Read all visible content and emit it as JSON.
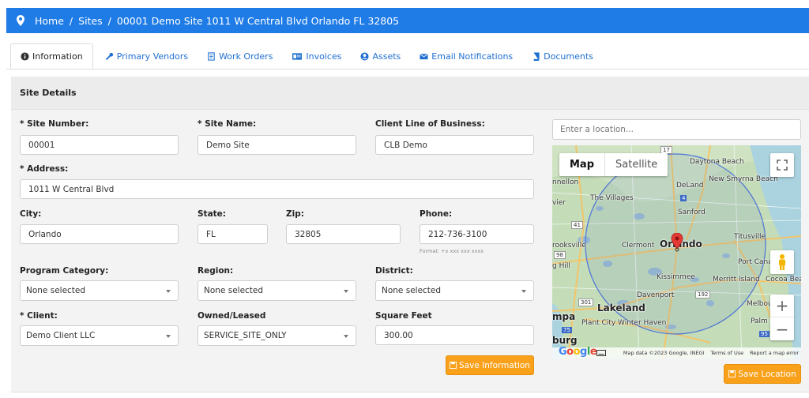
{
  "breadcrumb": {
    "home": "Home",
    "sites": "Sites",
    "current": "00001 Demo Site 1011 W Central Blvd Orlando FL 32805"
  },
  "tabs": [
    {
      "label": "Information",
      "icon": "info-icon"
    },
    {
      "label": "Primary Vendors",
      "icon": "wrench-icon"
    },
    {
      "label": "Work Orders",
      "icon": "document-icon"
    },
    {
      "label": "Invoices",
      "icon": "invoice-icon"
    },
    {
      "label": "Assets",
      "icon": "user-circle-icon"
    },
    {
      "label": "Email Notifications",
      "icon": "envelope-icon"
    },
    {
      "label": "Documents",
      "icon": "book-icon"
    }
  ],
  "section_title": "Site Details",
  "form": {
    "site_number": {
      "label": "* Site Number:",
      "value": "00001"
    },
    "site_name": {
      "label": "* Site Name:",
      "value": "Demo Site"
    },
    "client_lob": {
      "label": "Client Line of Business:",
      "value": "CLB Demo"
    },
    "address": {
      "label": "* Address:",
      "value": "1011 W Central Blvd"
    },
    "city": {
      "label": "City:",
      "value": "Orlando"
    },
    "state": {
      "label": "State:",
      "value": "FL"
    },
    "zip": {
      "label": "Zip:",
      "value": "32805"
    },
    "phone": {
      "label": "Phone:",
      "value": "212-736-3100",
      "hint": "Format: +x xxx xxx xxxx"
    },
    "program_category": {
      "label": "Program Category:",
      "value": "None selected"
    },
    "region": {
      "label": "Region:",
      "value": "None selected"
    },
    "district": {
      "label": "District:",
      "value": "None selected"
    },
    "client": {
      "label": "* Client:",
      "value": "Demo Client LLC"
    },
    "owned_leased": {
      "label": "Owned/Leased",
      "value": "SERVICE_SITE_ONLY"
    },
    "square_feet": {
      "label": "Square Feet",
      "value": "300.00"
    }
  },
  "buttons": {
    "save_information": "Save Information",
    "save_location": "Save Location"
  },
  "map": {
    "search_placeholder": "Enter a location...",
    "toggle_map": "Map",
    "toggle_satellite": "Satellite",
    "zoom_in": "+",
    "zoom_out": "−",
    "cities": [
      "Daytona Beach",
      "New Smyrna Beach",
      "DeLand",
      "The Villages",
      "Sanford",
      "Titusville",
      "Clermont",
      "Orlando",
      "Port Cana",
      "Kissimmee",
      "Merritt Island",
      "Cocoa Bea",
      "Davenport",
      "Lakeland",
      "Melbou",
      "Plant City",
      "Winter Haven",
      "Palm F",
      "nnellon",
      "rooksville",
      "g Hill",
      "mpa",
      "burg",
      "vier"
    ],
    "roads": [
      "17",
      "4",
      "41",
      "98",
      "301",
      "192",
      "95",
      "75"
    ],
    "google": "Google",
    "attribution": "Map data ©2023 Google, INEGI",
    "terms": "Terms of Use",
    "report": "Report a map error"
  },
  "colors": {
    "topbar": "#1f7ce6",
    "link": "#1f6fd1",
    "save": "#f9a11b"
  }
}
